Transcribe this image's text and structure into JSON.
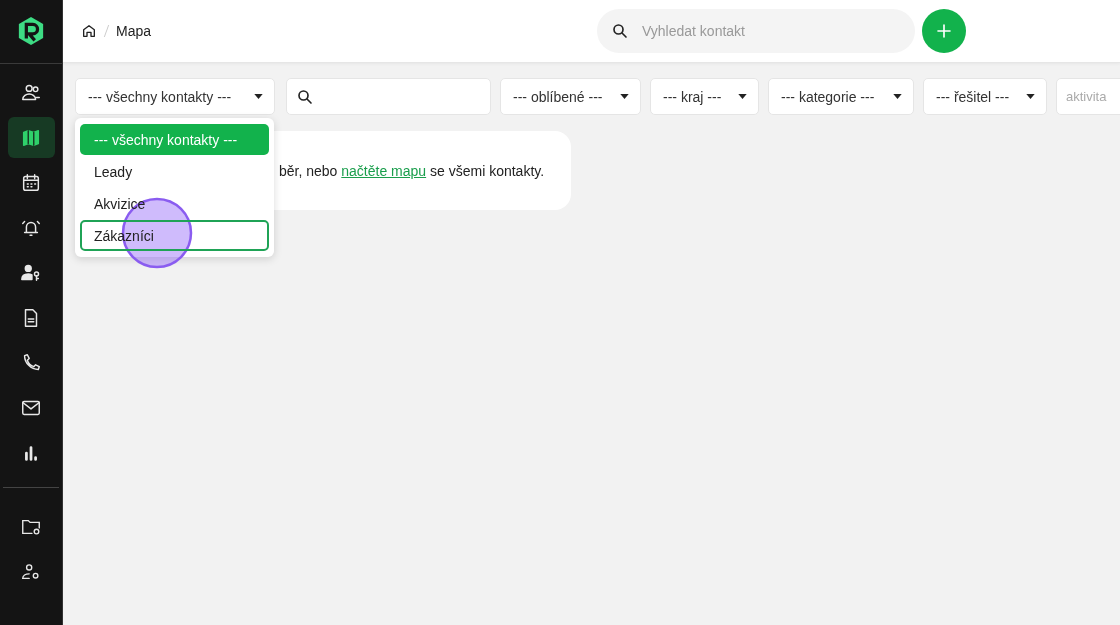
{
  "sidebar": {
    "items": [
      {
        "selected": false
      },
      {
        "selected": true
      },
      {
        "selected": false
      },
      {
        "selected": false
      },
      {
        "selected": false
      },
      {
        "selected": false
      },
      {
        "selected": false
      },
      {
        "selected": false
      },
      {
        "selected": false
      }
    ],
    "bottom_items": [
      {
        "selected": false
      },
      {
        "selected": false
      }
    ]
  },
  "breadcrumb": {
    "current": "Mapa"
  },
  "search": {
    "placeholder": "Vyhledat kontakt"
  },
  "filters": [
    {
      "kind": "select",
      "label": "--- všechny kontakty ---"
    },
    {
      "kind": "search"
    },
    {
      "kind": "select",
      "label": "--- oblíbené ---"
    },
    {
      "kind": "select",
      "label": "--- kraj ---"
    },
    {
      "kind": "select",
      "label": "--- kategorie ---"
    },
    {
      "kind": "select",
      "label": "--- řešitel ---"
    },
    {
      "kind": "input",
      "placeholder": "aktivita"
    }
  ],
  "dropdown": {
    "options": [
      {
        "label": "--- všechny kontakty ---",
        "selected": true,
        "focused": false
      },
      {
        "label": "Leady",
        "selected": false,
        "focused": false
      },
      {
        "label": "Akvizice",
        "selected": false,
        "focused": false
      },
      {
        "label": "Zákazníci",
        "selected": false,
        "focused": true
      }
    ]
  },
  "notice": {
    "before": "běr, nebo ",
    "link": "načtěte mapu",
    "after": " se všemi kontakty."
  },
  "click_indicator": true
}
